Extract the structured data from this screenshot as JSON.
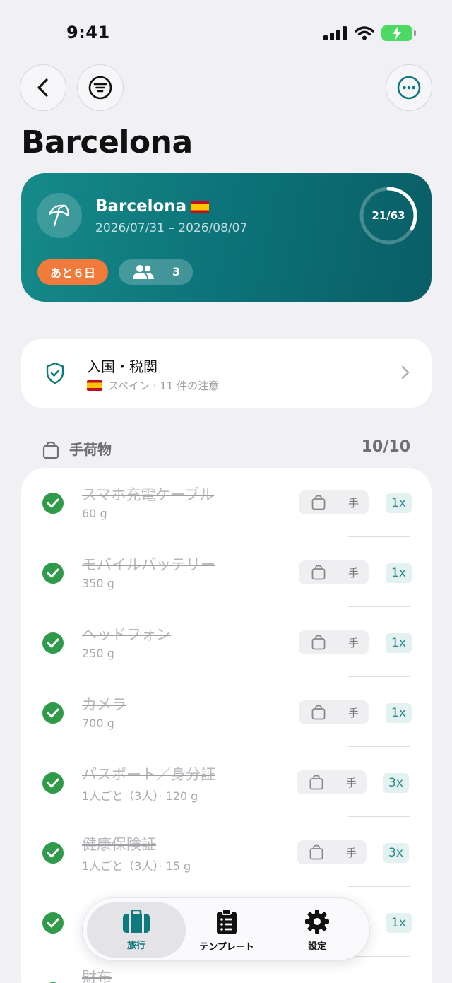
{
  "status": {
    "time": "9:41"
  },
  "header": {
    "title": "Barcelona"
  },
  "trip": {
    "name": "Barcelona",
    "dates": "2026/07/31 – 2026/08/07",
    "progress_text": "21/63",
    "progress_fraction": 0.333,
    "days_left": "あと６日",
    "people_count": "3"
  },
  "customs": {
    "title": "入国・税関",
    "subtitle": "スペイン · 11 件の注意"
  },
  "section": {
    "title": "手荷物",
    "count": "10/10"
  },
  "items": [
    {
      "name": "スマホ充電ケーブル",
      "meta": "60 g",
      "bag": "手",
      "qty": "1x"
    },
    {
      "name": "モバイルバッテリー",
      "meta": "350 g",
      "bag": "手",
      "qty": "1x"
    },
    {
      "name": "ヘッドフォン",
      "meta": "250 g",
      "bag": "手",
      "qty": "1x"
    },
    {
      "name": "カメラ",
      "meta": "700 g",
      "bag": "手",
      "qty": "1x"
    },
    {
      "name": "パスポート／身分証",
      "meta": "1人ごと（3人）· 120 g",
      "bag": "手",
      "qty": "3x"
    },
    {
      "name": "健康保険証",
      "meta": "1人ごと（3人）· 15 g",
      "bag": "手",
      "qty": "3x"
    },
    {
      "name": "",
      "meta": "",
      "bag": "",
      "qty": "1x"
    },
    {
      "name": "財布",
      "meta": "",
      "bag": "",
      "qty": ""
    }
  ],
  "tabs": [
    {
      "label": "旅行",
      "icon": "suitcase-icon"
    },
    {
      "label": "テンプレート",
      "icon": "clipboard-list-icon"
    },
    {
      "label": "設定",
      "icon": "gear-icon"
    }
  ],
  "colors": {
    "accent": "#0e7a7e",
    "done": "#2f9a4a",
    "badge": "#f07b3a"
  }
}
